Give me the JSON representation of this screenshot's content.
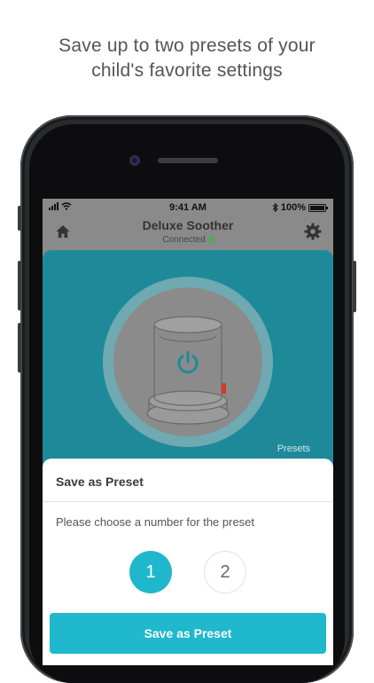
{
  "caption": {
    "line1": "Save up to two presets of your",
    "line2": "child's favorite settings"
  },
  "status_bar": {
    "time": "9:41 AM",
    "battery": "100%",
    "icons": [
      "signal-icon",
      "wifi-icon",
      "bluetooth-icon",
      "battery-icon"
    ]
  },
  "nav": {
    "title": "Deluxe Soother",
    "status": "Connected",
    "status_color": "#3ab54a",
    "left_icon": "home-icon",
    "right_icon": "gear-icon"
  },
  "panel": {
    "presets_label": "Presets",
    "color": "#1e8a99",
    "device_icon": "power-icon"
  },
  "sheet": {
    "title": "Save as Preset",
    "prompt": "Please choose a number for the preset",
    "options": [
      "1",
      "2"
    ],
    "selected": "1",
    "save_label": "Save as Preset",
    "accent": "#1fb7cc"
  }
}
